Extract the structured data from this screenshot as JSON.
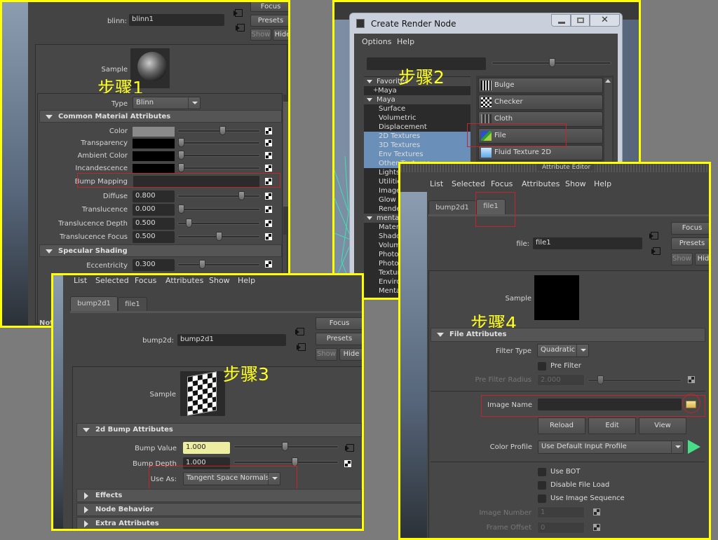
{
  "step_labels": {
    "step1": "步骤1",
    "step2": "步骤2",
    "step3": "步骤3",
    "step4": "步骤4"
  },
  "accent_colors": {
    "highlight_box": "#c0262b",
    "panel_border": "#ffff00",
    "selection": "#6a8fb8"
  },
  "blinn_editor": {
    "node_label": "blinn:",
    "node_name": "blinn1",
    "buttons": {
      "focus": "Focus",
      "presets": "Presets",
      "show": "Show",
      "hide": "Hide"
    },
    "sample_label": "Sample",
    "type_label": "Type",
    "type_value": "Blinn",
    "common_header": "Common Material Attributes",
    "attributes": [
      {
        "label": "Color",
        "kind": "swatch",
        "swatch": "#8a8a8a",
        "slider": 0.55
      },
      {
        "label": "Transparency",
        "kind": "swatch",
        "swatch": "#000000",
        "slider": 0.0
      },
      {
        "label": "Ambient Color",
        "kind": "swatch",
        "swatch": "#000000",
        "slider": 0.0
      },
      {
        "label": "Incandescence",
        "kind": "swatch",
        "swatch": "#000000",
        "slider": 0.0
      },
      {
        "label": "Bump Mapping",
        "kind": "map"
      },
      {
        "label": "Diffuse",
        "kind": "num",
        "value": "0.800",
        "slider": 0.8
      },
      {
        "label": "Translucence",
        "kind": "num",
        "value": "0.000",
        "slider": 0.0
      },
      {
        "label": "Translucence Depth",
        "kind": "num",
        "value": "0.500",
        "slider": 0.1
      },
      {
        "label": "Translucence Focus",
        "kind": "num",
        "value": "0.500",
        "slider": 0.5
      }
    ],
    "specular_header": "Specular Shading",
    "eccentricity_label": "Eccentricity",
    "eccentricity_value": "0.300",
    "bottom_partial": "Not"
  },
  "create_render_node": {
    "title": "Create Render Node",
    "menu": [
      "Options",
      "Help"
    ],
    "search_value": "",
    "tree": [
      {
        "label": "Favorites",
        "level": 0,
        "expander": "down"
      },
      {
        "label": "Maya",
        "level": 1,
        "expander": "plus"
      },
      {
        "label": "Maya",
        "level": 0,
        "expander": "down"
      },
      {
        "label": "Surface",
        "level": 2
      },
      {
        "label": "Volumetric",
        "level": 2
      },
      {
        "label": "Displacement",
        "level": 2
      },
      {
        "label": "2D Textures",
        "level": 2,
        "selected": true
      },
      {
        "label": "3D Textures",
        "level": 2,
        "selected": true
      },
      {
        "label": "Env Textures",
        "level": 2,
        "selected": true
      },
      {
        "label": "Other Textures",
        "level": 2,
        "selected": true
      },
      {
        "label": "Lights",
        "level": 2
      },
      {
        "label": "Utilities",
        "level": 2
      },
      {
        "label": "Image",
        "level": 2
      },
      {
        "label": "Glow",
        "level": 2
      },
      {
        "label": "Rendering",
        "level": 2
      },
      {
        "label": "mental ray",
        "level": 0,
        "expander": "down"
      },
      {
        "label": "Materials",
        "level": 2
      },
      {
        "label": "Shadows",
        "level": 2
      },
      {
        "label": "Volumetric",
        "level": 2
      },
      {
        "label": "Photonic",
        "level": 2
      },
      {
        "label": "Photon",
        "level": 2
      },
      {
        "label": "Textures",
        "level": 2
      },
      {
        "label": "Environment",
        "level": 2
      },
      {
        "label": "Mental",
        "level": 2
      }
    ],
    "nodes": [
      {
        "label": "Bulge",
        "icon": "bulge-icon"
      },
      {
        "label": "Checker",
        "icon": "checker-icon"
      },
      {
        "label": "Cloth",
        "icon": "cloth-icon"
      },
      {
        "label": "File",
        "icon": "file-texture-icon"
      },
      {
        "label": "Fluid Texture 2D",
        "icon": "fluid-texture-icon"
      }
    ]
  },
  "bump_editor": {
    "menu": [
      "List",
      "Selected",
      "Focus",
      "Attributes",
      "Show",
      "Help"
    ],
    "tabs": [
      "bump2d1",
      "file1"
    ],
    "node_label": "bump2d:",
    "node_name": "bump2d1",
    "buttons": {
      "focus": "Focus",
      "presets": "Presets",
      "show": "Show",
      "hide": "Hide"
    },
    "sample_label": "Sample",
    "header": "2d Bump Attributes",
    "bump_value_label": "Bump Value",
    "bump_value": "1.000",
    "bump_value_slider": 0.5,
    "bump_depth_label": "Bump Depth",
    "bump_depth": "1.000",
    "bump_depth_slider": 0.6,
    "use_as_label": "Use As:",
    "use_as_value": "Tangent Space Normals",
    "collapsed": [
      "Effects",
      "Node Behavior",
      "Extra Attributes"
    ]
  },
  "file_editor": {
    "window_title": "Attribute Editor",
    "menu": [
      "List",
      "Selected",
      "Focus",
      "Attributes",
      "Show",
      "Help"
    ],
    "tabs": [
      "bump2d1",
      "file1"
    ],
    "node_label": "file:",
    "node_name": "file1",
    "buttons": {
      "focus": "Focus",
      "presets": "Presets",
      "show": "Show",
      "hide": "Hide"
    },
    "sample_label": "Sample",
    "header": "File Attributes",
    "filter_type_label": "Filter Type",
    "filter_type_value": "Quadratic",
    "pre_filter_label": "Pre Filter",
    "pre_filter_radius_label": "Pre Filter Radius",
    "pre_filter_radius": "2.000",
    "pre_filter_radius_slider": 0.1,
    "image_name_label": "Image Name",
    "image_name_value": "",
    "reload": "Reload",
    "edit": "Edit",
    "view": "View",
    "color_profile_label": "Color Profile",
    "color_profile_value": "Use Default Input Profile",
    "use_bot": "Use BOT",
    "disable_file_load": "Disable File Load",
    "use_image_sequence": "Use Image Sequence",
    "image_number_label": "Image Number",
    "image_number": "1",
    "frame_offset_label": "Frame Offset",
    "frame_offset": "0"
  }
}
